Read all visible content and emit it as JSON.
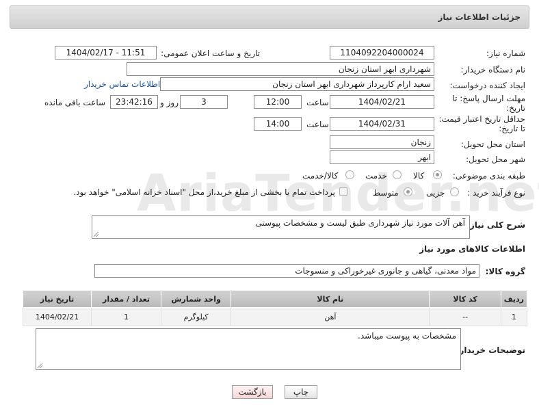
{
  "header": {
    "title": "جزئیات اطلاعات نیاز"
  },
  "fields": {
    "need_number": {
      "label": "شماره نیاز:",
      "value": "1104092204000024"
    },
    "announce_date": {
      "label": "تاریخ و ساعت اعلان عمومی:",
      "value": "1404/02/17 - 11:51"
    },
    "buyer_org": {
      "label": "نام دستگاه خریدار:",
      "value": "شهرداری ابهر استان زنجان"
    },
    "requester": {
      "label": "ایجاد کننده درخواست:",
      "value": "سعید ارام کارپرداز  شهرداری ابهر استان زنجان",
      "link": "اطلاعات تماس خریدار"
    },
    "reply_deadline": {
      "label": "مهلت ارسال پاسخ: تا تاریخ:",
      "date": "1404/02/21",
      "time_label": "ساعت",
      "time": "12:00",
      "days": "3",
      "days_label": "روز و",
      "remaining": "23:42:16",
      "remaining_label": "ساعت باقی مانده"
    },
    "price_validity": {
      "label": "حداقل تاریخ اعتبار قیمت: تا تاریخ:",
      "date": "1404/02/31",
      "time_label": "ساعت",
      "time": "14:00"
    },
    "delivery_province": {
      "label": "استان محل تحویل:",
      "value": "زنجان"
    },
    "delivery_city": {
      "label": "شهر محل تحویل:",
      "value": "ابهر"
    },
    "category": {
      "label": "طبقه بندی موضوعی:",
      "options": [
        "کالا",
        "خدمت",
        "کالا/خدمت"
      ],
      "selected": "کالا"
    },
    "process_type": {
      "label": "نوع فرآیند خرید :",
      "options": [
        "جزیی",
        "متوسط"
      ],
      "selected": "متوسط",
      "payment_note": "پرداخت تمام یا بخشی از مبلغ خرید،از محل \"اسناد خزانه اسلامی\" خواهد بود."
    }
  },
  "description": {
    "label": "شرح کلی نیاز:",
    "value": "آهن آلات مورد نیاز شهرداری طبق لیست و مشخصات پیوستی"
  },
  "goods_section": {
    "title": "اطلاعات کالاهای مورد نیاز",
    "group_label": "گروه کالا:",
    "group_value": "مواد معدنی، گیاهی و جانوری غیرخوراکی و منسوجات"
  },
  "table": {
    "headers": [
      "ردیف",
      "کد کالا",
      "نام کالا",
      "واحد شمارش",
      "تعداد / مقدار",
      "تاریخ نیاز"
    ],
    "rows": [
      [
        "1",
        "--",
        "آهن",
        "کیلوگرم",
        "1",
        "1404/02/21"
      ]
    ]
  },
  "buyer_notes": {
    "label": "توضیحات خریدار:",
    "value": "مشخصات به پیوست میباشد."
  },
  "buttons": {
    "print": "چاپ",
    "back": "بازگشت"
  },
  "watermark": "AriaTender.net"
}
